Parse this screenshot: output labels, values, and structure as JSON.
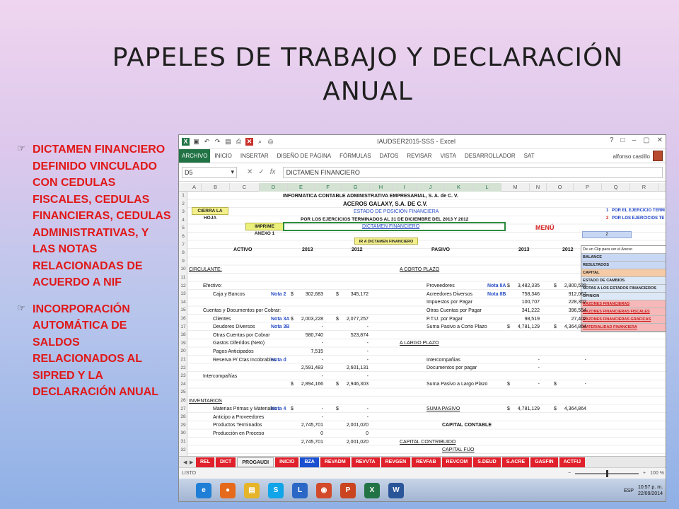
{
  "slide": {
    "title": "PAPELES DE TRABAJO Y DECLARACIÓN ANUAL",
    "bullets": [
      "DICTAMEN FINANCIERO DEFINIDO VINCULADO CON CEDULAS FISCALES, CEDULAS FINANCIERAS, CEDULAS ADMINISTRATIVAS, Y LAS  NOTAS RELACIONADAS DE ACUERDO A NIF",
      " INCORPORACIÓN AUTOMÁTICA DE SALDOS RELACIONADOS AL SIPRED Y LA DECLARACIÓN ANUAL"
    ]
  },
  "excel": {
    "window_title": "IAUDSER2015-SSS - Excel",
    "ribbon_tabs": [
      "ARCHIVO",
      "INICIO",
      "INSERTAR",
      "DISEÑO DE PÁGINA",
      "FÓRMULAS",
      "DATOS",
      "REVISAR",
      "VISTA",
      "DESARROLLADOR",
      "SAT"
    ],
    "user": "alfonso castillo",
    "name_box": "D5",
    "formula": "DICTAMEN FINANCIERO",
    "columns": [
      "A",
      "B",
      "C",
      "D",
      "E",
      "F",
      "G",
      "H",
      "I",
      "J",
      "K",
      "L",
      "M",
      "N",
      "O",
      "P",
      "Q",
      "R"
    ],
    "rows": [
      "1",
      "2",
      "3",
      "4",
      "5",
      "6",
      "7",
      "8",
      "9",
      "10",
      "11",
      "12",
      "13",
      "14",
      "15",
      "16",
      "17",
      "18",
      "19",
      "20",
      "21",
      "22",
      "23",
      "24",
      "25",
      "26",
      "27",
      "28",
      "29",
      "30",
      "31",
      "32"
    ],
    "sheet": {
      "company": "INFORMATICA CONTABLE ADMINISTRATIVA EMPRESARIAL, S. A. de C. V.",
      "client": "ACEROS GALAXY, S.A. DE C.V.",
      "statement": "ESTADO DE POSICIÓN FINANCIERA",
      "period": "POR LOS EJERCICIOS TERMINADOS AL 31 DE DICIEMBRE DEL 2013 Y 2012",
      "close_button": "CIERRA LA HOJA",
      "print_annex": "IMPRIME ANEXO 1",
      "dictamen_link": "DICTAMEN FINANCIERO",
      "menu_link": "MENÚ",
      "goto_dictamen": "IR A DICTAMEN FINANCIERO",
      "right_note_1": "1",
      "right_note_1_text": "POR EL EJERCICIO TERM",
      "right_note_2": "2",
      "right_note_2_text": "POR LOS EJERCICIOS TE",
      "selector_value": "2",
      "clip_hint": "De un Clip para ver el Anexo",
      "menu_items": [
        "BALANCE",
        "RESULTADOS",
        "CAPITAL",
        "ESTADO DE CAMBIOS",
        "NOTAS A LOS ESTADOS FINANCIEROS",
        "OPINION",
        "RAZONES FINANCIERAS",
        "RAZONES FINANCIERAS FISCALES",
        "RAZONES FINANCIERAS GRAFICAS",
        "MATERIALIDAD FINANCIERA"
      ],
      "headers": {
        "activo": "ACTIVO",
        "pasivo": "PASIVO",
        "y2013": "2013",
        "y2012": "2012"
      },
      "left_rows": [
        {
          "row": 10,
          "label": "CIRCULANTE:",
          "indent": 0,
          "underline": true
        },
        {
          "row": 12,
          "label": "Efectivo:",
          "indent": 1
        },
        {
          "row": 13,
          "label": "Caja y Bancos",
          "indent": 2,
          "note": "Nota 2",
          "cur1": "$",
          "v2013": "302,683",
          "cur2": "$",
          "v2012": "345,172"
        },
        {
          "row": 15,
          "label": "Cuentas y Documentos por Cobrar:",
          "indent": 1
        },
        {
          "row": 16,
          "label": "Clientes",
          "indent": 2,
          "note": "Nota 3A",
          "cur1": "$",
          "v2013": "2,003,228",
          "cur2": "$",
          "v2012": "2,077,257"
        },
        {
          "row": 17,
          "label": "Deudores Diversos",
          "indent": 2,
          "note": "Nota 3B",
          "v2013": "-",
          "v2012": "-"
        },
        {
          "row": 18,
          "label": "Otras Cuentas por Cobrar",
          "indent": 2,
          "v2013": "580,740",
          "v2012": "523,874"
        },
        {
          "row": 19,
          "label": "Gastos Diferidos (Neto)",
          "indent": 2,
          "v2013": "-",
          "v2012": "-"
        },
        {
          "row": 20,
          "label": "Pagos Anticipados",
          "indent": 2,
          "v2013": "7,515",
          "v2012": "-"
        },
        {
          "row": 21,
          "label": "Reserva P/ Ctas Incobrables",
          "indent": 2,
          "note": "Nota d",
          "v2013": "-",
          "v2012": "-"
        },
        {
          "row": 22,
          "label": "",
          "indent": 2,
          "v2013": "2,591,483",
          "v2012": "2,601,131"
        },
        {
          "row": 23,
          "label": "Intercompañías",
          "indent": 1,
          "v2013": "-",
          "v2012": "-"
        },
        {
          "row": 24,
          "label": "",
          "indent": 2,
          "cur1": "$",
          "v2013": "2,894,166",
          "cur2": "$",
          "v2012": "2,946,303"
        },
        {
          "row": 26,
          "label": "INVENTARIOS",
          "indent": 0,
          "underline": true
        },
        {
          "row": 27,
          "label": "Materias Primas y Materiales",
          "indent": 2,
          "note": "Nota 4",
          "cur1": "$",
          "v2013": "-",
          "cur2": "$",
          "v2012": "-"
        },
        {
          "row": 28,
          "label": "Anticipo a Proveedores",
          "indent": 2,
          "v2013": "-",
          "v2012": "-"
        },
        {
          "row": 29,
          "label": "Productos Terminados",
          "indent": 2,
          "v2013": "2,745,701",
          "v2012": "2,001,020"
        },
        {
          "row": 30,
          "label": "Producción en Proceso",
          "indent": 2,
          "v2013": "0",
          "v2012": "0"
        },
        {
          "row": 31,
          "label": "",
          "indent": 2,
          "v2013": "2,745,701",
          "v2012": "2,001,020"
        }
      ],
      "right_rows": [
        {
          "row": 10,
          "label": "A CORTO PLAZO",
          "underline": true
        },
        {
          "row": 12,
          "label": "Proveedores",
          "note": "Nota 8A",
          "cur1": "$",
          "v2013": "3,482,335",
          "cur2": "$",
          "v2012": "2,800,539"
        },
        {
          "row": 13,
          "label": "Acreedores Diversos",
          "note": "Nota 8B",
          "v2013": "758,346",
          "v2012": "912,067"
        },
        {
          "row": 14,
          "label": "Impuestos por Pagar",
          "v2013": "100,707",
          "v2012": "228,302"
        },
        {
          "row": 15,
          "label": "Otras Cuentas por Pagar",
          "v2013": "341,222",
          "v2012": "396,554"
        },
        {
          "row": 16,
          "label": "P.T.U. por Pagar",
          "v2013": "98,519",
          "v2012": "27,402"
        },
        {
          "row": 17,
          "label": "Suma Pasivo a Corto Plazo",
          "cur1": "$",
          "v2013": "4,781,129",
          "cur2": "$",
          "v2012": "4,364,864"
        },
        {
          "row": 19,
          "label": "A LARGO PLAZO",
          "underline": true
        },
        {
          "row": 21,
          "label": "Intercompañias",
          "v2013": "-",
          "v2012": "-"
        },
        {
          "row": 22,
          "label": "Documentos por pagar",
          "v2013": "-",
          "v2012": ""
        },
        {
          "row": 24,
          "label": "Suma Pasivo a Largo Plazo",
          "cur1": "$",
          "v2013": "-",
          "cur2": "$",
          "v2012": "-"
        },
        {
          "row": 27,
          "label": "SUMA PASIVO",
          "underline": true,
          "cur1": "$",
          "v2013": "4,781,129",
          "cur2": "$",
          "v2012": "4,364,864"
        },
        {
          "row": 29,
          "label": "CAPITAL CONTABLE",
          "bold": true,
          "center": true
        },
        {
          "row": 31,
          "label": "CAPITAL CONTRIBUIDO",
          "underline": true
        },
        {
          "row": 32,
          "label": "CAPITAL FIJO",
          "center": true,
          "underline": true
        }
      ]
    },
    "sheet_tabs": [
      {
        "label": "REL",
        "color": "#e0202a"
      },
      {
        "label": "DICT",
        "color": "#e0202a"
      },
      {
        "label": "PROGAUDI",
        "color": "#f2f2f2"
      },
      {
        "label": "INICIO",
        "color": "#e0202a"
      },
      {
        "label": "BZA",
        "color": "#1a4fd0"
      },
      {
        "label": "REVADM",
        "color": "#e0202a"
      },
      {
        "label": "REVVTA",
        "color": "#e0202a"
      },
      {
        "label": "REVGEN",
        "color": "#e0202a"
      },
      {
        "label": "REVFAB",
        "color": "#e0202a"
      },
      {
        "label": "REVCOM",
        "color": "#e0202a"
      },
      {
        "label": "S.DEUD",
        "color": "#e0202a"
      },
      {
        "label": "S.ACRE",
        "color": "#e0202a"
      },
      {
        "label": "GASFIN",
        "color": "#e0202a"
      },
      {
        "label": "ACTFIJ",
        "color": "#e0202a"
      }
    ],
    "status": "LISTO",
    "zoom": "100 %",
    "clock_time": "10:57 p. m.",
    "clock_date": "22/09/2014",
    "lang": "ESP",
    "taskbar_icons": [
      {
        "name": "internet-explorer-icon",
        "glyph": "e",
        "color": "#1f7fd6"
      },
      {
        "name": "firefox-icon",
        "glyph": "●",
        "color": "#e56a1c"
      },
      {
        "name": "file-explorer-icon",
        "glyph": "▤",
        "color": "#e6b428"
      },
      {
        "name": "skype-icon",
        "glyph": "S",
        "color": "#10a5e8"
      },
      {
        "name": "lync-icon",
        "glyph": "L",
        "color": "#2b68c6"
      },
      {
        "name": "media-icon",
        "glyph": "◉",
        "color": "#d24a2a"
      },
      {
        "name": "powerpoint-icon",
        "glyph": "P",
        "color": "#c9441f"
      },
      {
        "name": "excel-icon",
        "glyph": "X",
        "color": "#217346"
      },
      {
        "name": "word-icon",
        "glyph": "W",
        "color": "#2a5699"
      }
    ],
    "colors": {
      "excel_green": "#217346",
      "link_blue": "#2a4fc4",
      "alert_red": "#e01818"
    }
  }
}
